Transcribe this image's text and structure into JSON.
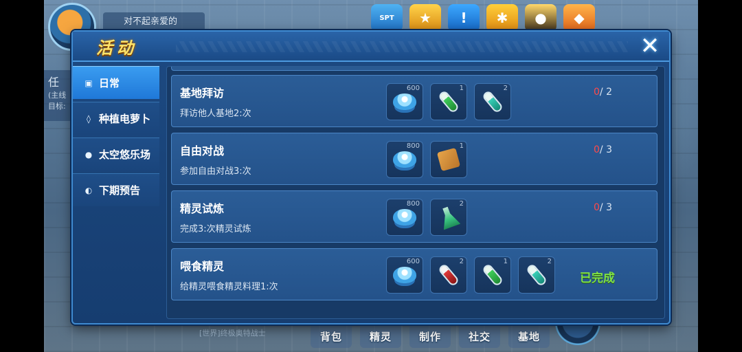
{
  "hud": {
    "player_name": "对不起亲爱的",
    "quest_tag_line1": "任",
    "quest_tag_line2": "(主线",
    "quest_tag_line3": "目标:",
    "top_icons": [
      {
        "icon": "spt-icon",
        "label": "SPT"
      },
      {
        "icon": "trophy-icon",
        "label": ""
      },
      {
        "icon": "alert-icon",
        "label": "!"
      },
      {
        "icon": "star-icon",
        "label": ""
      },
      {
        "icon": "pet-icon",
        "label": ""
      },
      {
        "icon": "gem-icon",
        "label": ""
      }
    ],
    "bottom_buttons": [
      "背包",
      "精灵",
      "制作",
      "社交",
      "基地"
    ],
    "world_chat": "[世界]终极奥特战士"
  },
  "panel": {
    "title": "活动",
    "close_label": "✕"
  },
  "sidebar": {
    "items": [
      {
        "label": "日常",
        "icon": "gift-icon",
        "active": true
      },
      {
        "label": "种植电萝卜",
        "icon": "carrot-icon",
        "active": false
      },
      {
        "label": "太空悠乐场",
        "icon": "paw-icon",
        "active": false
      },
      {
        "label": "下期预告",
        "icon": "planet-icon",
        "active": false
      }
    ]
  },
  "tasks": [
    {
      "title": "基地拜访",
      "desc": "拜访他人基地2:次",
      "rewards": [
        {
          "item": "gem",
          "count": "600"
        },
        {
          "item": "green-capsule",
          "count": "1"
        },
        {
          "item": "teal-capsule",
          "count": "2"
        }
      ],
      "progress_current": "0",
      "progress_total": "/ 2",
      "status": ""
    },
    {
      "title": "自由对战",
      "desc": "参加自由对战3:次",
      "rewards": [
        {
          "item": "gem",
          "count": "800"
        },
        {
          "item": "bag",
          "count": "1"
        }
      ],
      "progress_current": "0",
      "progress_total": "/ 3",
      "status": ""
    },
    {
      "title": "精灵试炼",
      "desc": "完成3:次精灵试炼",
      "rewards": [
        {
          "item": "gem",
          "count": "800"
        },
        {
          "item": "flask",
          "count": "2"
        }
      ],
      "progress_current": "0",
      "progress_total": "/ 3",
      "status": ""
    },
    {
      "title": "喂食精灵",
      "desc": "给精灵喂食精灵料理1:次",
      "rewards": [
        {
          "item": "gem",
          "count": "600"
        },
        {
          "item": "red-capsule",
          "count": "2"
        },
        {
          "item": "green-capsule",
          "count": "1"
        },
        {
          "item": "teal-capsule",
          "count": "2"
        }
      ],
      "progress_current": "",
      "progress_total": "",
      "status": "已完成"
    }
  ],
  "colors": {
    "title_gold": "#ffe36a",
    "progress_red": "#ff4a4a",
    "done_green": "#7fe046",
    "panel_blue": "#1d4a82",
    "active_tab": "#2f8ae6"
  }
}
